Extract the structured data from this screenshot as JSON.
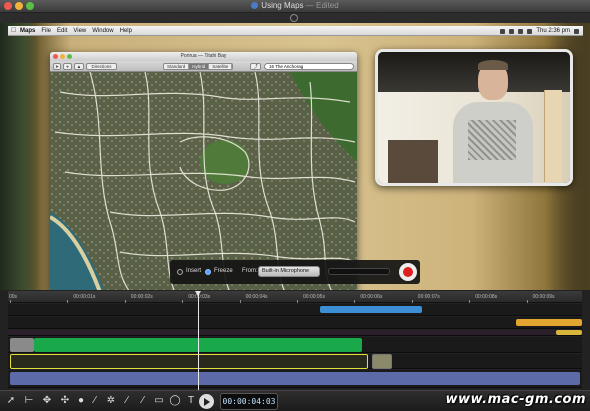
{
  "window": {
    "title": "Using Maps",
    "edited": "— Edited",
    "buttons": [
      "close",
      "minimize",
      "zoom"
    ]
  },
  "menubar": {
    "apple": "",
    "items": [
      "Maps",
      "File",
      "Edit",
      "View",
      "Window",
      "Help"
    ],
    "clock": "Thu 2:36 pm"
  },
  "maps_window": {
    "title": "Porirua — Titahi Bay",
    "directions_label": "Directions",
    "map_types": [
      "Standard",
      "Hybrid",
      "Satellite"
    ],
    "selected_map_type": "Hybrid",
    "search_value": "16 The Anchorag"
  },
  "recorder": {
    "insert_label": "Insert",
    "freeze_label": "Freeze",
    "selected_mode": "Freeze",
    "from_label": "From:",
    "source": "Built-in Microphone",
    "record_button": "record"
  },
  "timeline": {
    "ruler_labels": [
      "00s",
      "00:00:01s",
      "00:00:02s",
      "00:00:03s",
      "00:00:04s",
      "00:00:05s",
      "00:00:06s",
      "00:00:07s",
      "00:00:08s",
      "00:00:09s"
    ],
    "timecode": "00:00:04:03",
    "clips": [
      {
        "kind": "audio",
        "color": "#3c8fd4"
      },
      {
        "kind": "title",
        "color": "#e1a530"
      },
      {
        "kind": "title",
        "color": "#d8b53b"
      },
      {
        "kind": "video",
        "color": "#19a84a"
      },
      {
        "kind": "screen",
        "color": "#e3df3d"
      },
      {
        "kind": "audio",
        "color": "#5d6aa8"
      }
    ]
  },
  "toolbar": {
    "tools": [
      "pointer-tool",
      "blade-tool",
      "transform-tool",
      "effects-tool",
      "voiceover-tool",
      "brush-tool",
      "freeze-tool",
      "pen-tool",
      "highlight-tool",
      "rectangle-tool",
      "ellipse-tool",
      "text-tool"
    ]
  },
  "watermark": "www.mac-gm.com"
}
